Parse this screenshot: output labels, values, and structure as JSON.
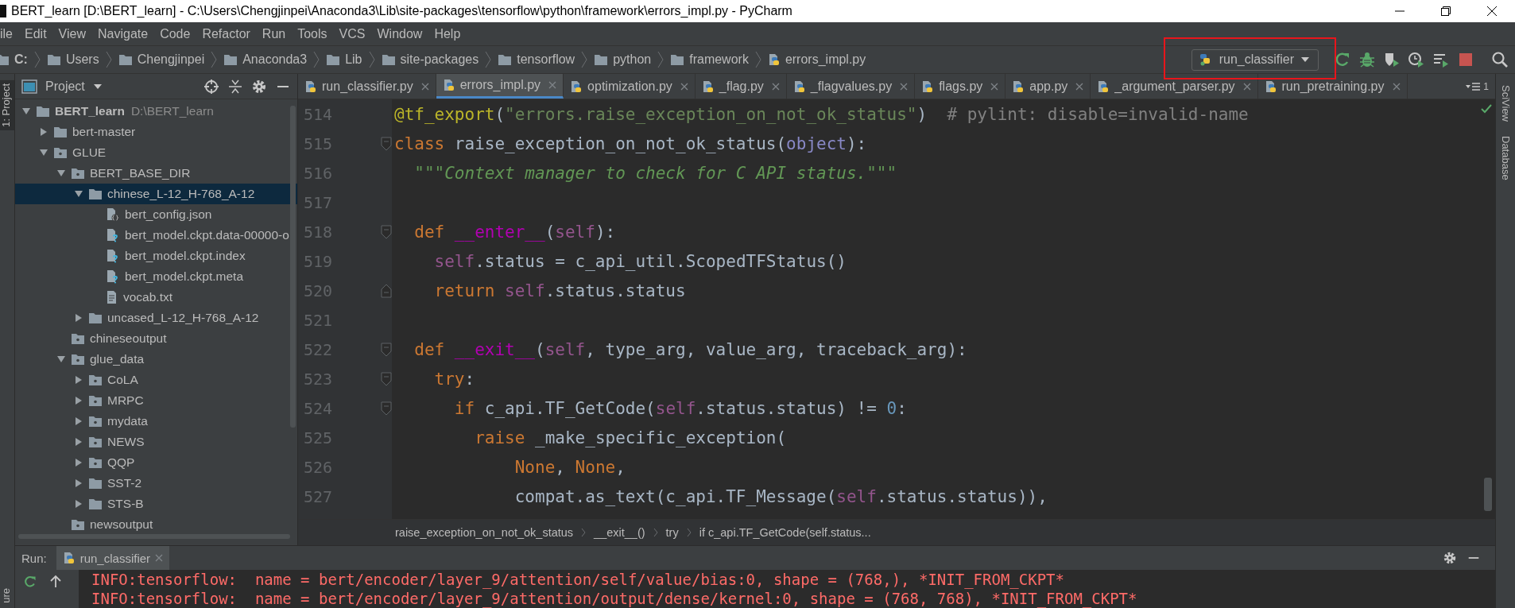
{
  "window": {
    "title": "BERT_learn [D:\\BERT_learn] - C:\\Users\\Chengjinpei\\Anaconda3\\Lib\\site-packages\\tensorflow\\python\\framework\\errors_impl.py - PyCharm"
  },
  "menu": [
    "ile",
    "Edit",
    "View",
    "Navigate",
    "Code",
    "Refactor",
    "Run",
    "Tools",
    "VCS",
    "Window",
    "Help"
  ],
  "breadcrumbs": [
    "C:",
    "Users",
    "Chengjinpei",
    "Anaconda3",
    "Lib",
    "site-packages",
    "tensorflow",
    "python",
    "framework",
    "errors_impl.py"
  ],
  "run_config": {
    "label": "run_classifier"
  },
  "left_strip": [
    "1: Project",
    "ure"
  ],
  "right_strip": [
    "SciView",
    "Database"
  ],
  "project_panel": {
    "title": "Project",
    "tree": [
      {
        "label": "BERT_learn",
        "path": "D:\\BERT_learn",
        "kind": "folder",
        "expanded": true,
        "selected": false,
        "children": [
          {
            "label": "bert-master",
            "kind": "folder",
            "expanded": false,
            "selected": false
          },
          {
            "label": "GLUE",
            "kind": "package",
            "expanded": true,
            "selected": false,
            "children": [
              {
                "label": "BERT_BASE_DIR",
                "kind": "package",
                "expanded": true,
                "selected": false,
                "children": [
                  {
                    "label": "chinese_L-12_H-768_A-12",
                    "kind": "folder",
                    "expanded": true,
                    "selected": true,
                    "children": [
                      {
                        "label": "bert_config.json",
                        "kind": "json",
                        "selected": false
                      },
                      {
                        "label": "bert_model.ckpt.data-00000-o",
                        "kind": "unknown",
                        "selected": false
                      },
                      {
                        "label": "bert_model.ckpt.index",
                        "kind": "unknown",
                        "selected": false
                      },
                      {
                        "label": "bert_model.ckpt.meta",
                        "kind": "unknown",
                        "selected": false
                      },
                      {
                        "label": "vocab.txt",
                        "kind": "text",
                        "selected": false
                      }
                    ]
                  },
                  {
                    "label": "uncased_L-12_H-768_A-12",
                    "kind": "folder",
                    "expanded": false,
                    "selected": false
                  }
                ]
              },
              {
                "label": "chineseoutput",
                "kind": "package",
                "selected": false
              },
              {
                "label": "glue_data",
                "kind": "package",
                "expanded": true,
                "selected": false,
                "children": [
                  {
                    "label": "CoLA",
                    "kind": "package",
                    "expanded": false,
                    "selected": false
                  },
                  {
                    "label": "MRPC",
                    "kind": "package",
                    "expanded": false,
                    "selected": false
                  },
                  {
                    "label": "mydata",
                    "kind": "package",
                    "expanded": false,
                    "selected": false
                  },
                  {
                    "label": "NEWS",
                    "kind": "package",
                    "expanded": false,
                    "selected": false
                  },
                  {
                    "label": "QQP",
                    "kind": "package",
                    "expanded": false,
                    "selected": false
                  },
                  {
                    "label": "SST-2",
                    "kind": "folder",
                    "expanded": false,
                    "selected": false
                  },
                  {
                    "label": "STS-B",
                    "kind": "folder",
                    "expanded": false,
                    "selected": false
                  }
                ]
              },
              {
                "label": "newsoutput",
                "kind": "package",
                "selected": false
              }
            ]
          }
        ]
      }
    ]
  },
  "tabs": [
    {
      "label": "run_classifier.py",
      "selected": false
    },
    {
      "label": "errors_impl.py",
      "selected": true
    },
    {
      "label": "optimization.py",
      "selected": false
    },
    {
      "label": "_flag.py",
      "selected": false
    },
    {
      "label": "_flagvalues.py",
      "selected": false
    },
    {
      "label": "flags.py",
      "selected": false
    },
    {
      "label": "app.py",
      "selected": false
    },
    {
      "label": "_argument_parser.py",
      "selected": false
    },
    {
      "label": "run_pretraining.py",
      "selected": false
    }
  ],
  "hidden_tabs_count": "1",
  "code_lines": [
    {
      "number": "514",
      "fold_start": false,
      "fold_end": false,
      "tokens": [
        {
          "kind": "decorator",
          "text": "@tf_export"
        },
        {
          "kind": "plain",
          "text": "("
        },
        {
          "kind": "string",
          "text": "\"errors.raise_exception_on_not_ok_status\""
        },
        {
          "kind": "plain",
          "text": ")"
        },
        {
          "kind": "comment",
          "text": "  # pylint: disable=invalid-name"
        }
      ]
    },
    {
      "number": "515",
      "fold_start": true,
      "fold_end": false,
      "tokens": [
        {
          "kind": "keyword",
          "text": "class"
        },
        {
          "kind": "plain",
          "text": " raise_exception_on_not_ok_status("
        },
        {
          "kind": "builtin",
          "text": "object"
        },
        {
          "kind": "plain",
          "text": "):"
        }
      ]
    },
    {
      "number": "516",
      "fold_start": false,
      "fold_end": false,
      "tokens": [
        {
          "kind": "docstring",
          "text": "  \"\"\"Context manager to check for C API status.\"\"\""
        }
      ]
    },
    {
      "number": "517",
      "fold_start": false,
      "fold_end": false
    },
    {
      "number": "518",
      "fold_start": true,
      "fold_end": false,
      "tokens": [
        {
          "kind": "keyword",
          "text": "  def"
        },
        {
          "kind": "magic",
          "text": " __enter__"
        },
        {
          "kind": "plain",
          "text": "("
        },
        {
          "kind": "self",
          "text": "self"
        },
        {
          "kind": "plain",
          "text": "):"
        }
      ]
    },
    {
      "number": "519",
      "fold_start": false,
      "fold_end": false,
      "tokens": [
        {
          "kind": "self",
          "text": "    self"
        },
        {
          "kind": "plain",
          "text": ".status = c_api_util.ScopedTFStatus()"
        }
      ]
    },
    {
      "number": "520",
      "fold_start": false,
      "fold_end": true,
      "tokens": [
        {
          "kind": "keyword",
          "text": "    return"
        },
        {
          "kind": "self",
          "text": " self"
        },
        {
          "kind": "plain",
          "text": ".status.status"
        }
      ]
    },
    {
      "number": "521",
      "fold_start": false,
      "fold_end": false
    },
    {
      "number": "522",
      "fold_start": true,
      "fold_end": false,
      "tokens": [
        {
          "kind": "keyword",
          "text": "  def"
        },
        {
          "kind": "magic",
          "text": " __exit__"
        },
        {
          "kind": "plain",
          "text": "("
        },
        {
          "kind": "self",
          "text": "self"
        },
        {
          "kind": "plain",
          "text": ", type_arg, value_arg, traceback_arg):"
        }
      ]
    },
    {
      "number": "523",
      "fold_start": true,
      "fold_end": false,
      "tokens": [
        {
          "kind": "keyword",
          "text": "    try"
        },
        {
          "kind": "plain",
          "text": ":"
        }
      ]
    },
    {
      "number": "524",
      "fold_start": true,
      "fold_end": false,
      "tokens": [
        {
          "kind": "keyword",
          "text": "      if"
        },
        {
          "kind": "plain",
          "text": " c_api.TF_GetCode("
        },
        {
          "kind": "self",
          "text": "self"
        },
        {
          "kind": "plain",
          "text": ".status.status) != "
        },
        {
          "kind": "number",
          "text": "0"
        },
        {
          "kind": "plain",
          "text": ":"
        }
      ]
    },
    {
      "number": "525",
      "fold_start": false,
      "fold_end": false,
      "tokens": [
        {
          "kind": "keyword",
          "text": "        raise"
        },
        {
          "kind": "plain",
          "text": " _make_specific_exception("
        }
      ]
    },
    {
      "number": "526",
      "fold_start": false,
      "fold_end": false,
      "tokens": [
        {
          "kind": "keyword",
          "text": "            None"
        },
        {
          "kind": "plain",
          "text": ", "
        },
        {
          "kind": "keyword",
          "text": "None"
        },
        {
          "kind": "plain",
          "text": ","
        }
      ]
    },
    {
      "number": "527",
      "fold_start": false,
      "fold_end": false,
      "tokens": [
        {
          "kind": "plain",
          "text": "            compat.as_text(c_api.TF_Message("
        },
        {
          "kind": "self",
          "text": "self"
        },
        {
          "kind": "plain",
          "text": ".status.status)),"
        }
      ]
    }
  ],
  "editor_breadcrumbs": [
    "raise_exception_on_not_ok_status",
    "__exit__()",
    "try",
    "if c_api.TF_GetCode(self.status..."
  ],
  "run_panel": {
    "label": "Run:",
    "tab": "run_classifier",
    "output": [
      "INFO:tensorflow:  name = bert/encoder/layer_9/attention/self/value/bias:0, shape = (768,), *INIT_FROM_CKPT*",
      "INFO:tensorflow:  name = bert/encoder/layer_9/attention/output/dense/kernel:0, shape = (768, 768), *INIT_FROM_CKPT*"
    ]
  }
}
